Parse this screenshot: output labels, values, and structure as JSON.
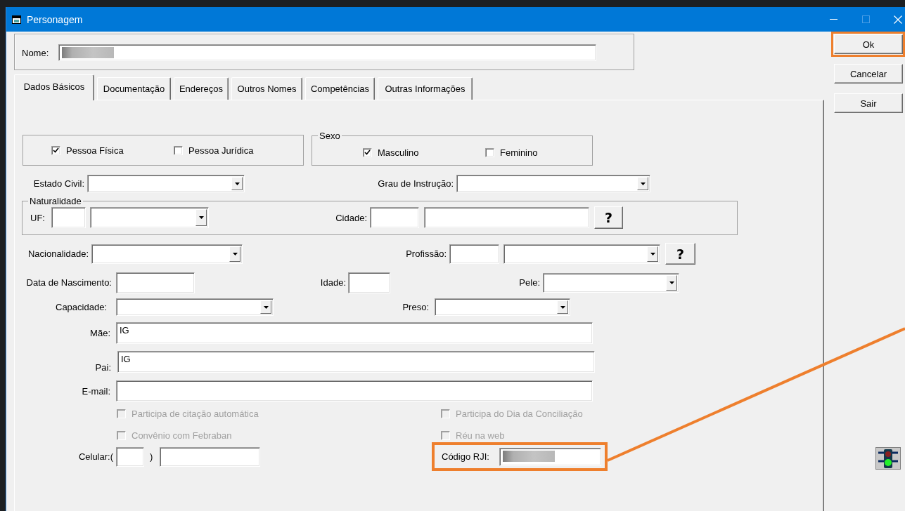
{
  "window": {
    "title": "Personagem"
  },
  "nome": {
    "label": "Nome:",
    "redacted": true
  },
  "buttons": [
    {
      "label": "Ok",
      "highlighted": true
    },
    {
      "label": "Cancelar",
      "highlighted": false
    },
    {
      "label": "Sair",
      "highlighted": false
    }
  ],
  "tabs": [
    {
      "label": "Dados Básicos",
      "selected": true
    },
    {
      "label": "Documentação",
      "selected": false
    },
    {
      "label": "Endereços",
      "selected": false
    },
    {
      "label": "Outros Nomes",
      "selected": false
    },
    {
      "label": "Competências",
      "selected": false
    },
    {
      "label": "Outras Informações",
      "selected": false
    }
  ],
  "pessoa": [
    {
      "label": "Pessoa Física",
      "checked": true
    },
    {
      "label": "Pessoa Jurídica",
      "checked": false
    }
  ],
  "sexo": {
    "title": "Sexo",
    "options": [
      {
        "label": "Masculino",
        "checked": true
      },
      {
        "label": "Feminino",
        "checked": false
      }
    ]
  },
  "estado_civil": {
    "label": "Estado Civil:"
  },
  "grau_instrucao": {
    "label": "Grau de Instrução:"
  },
  "naturalidade": {
    "title": "Naturalidade",
    "uf_label": "UF:",
    "cidade_label": "Cidade:",
    "help_button": "?"
  },
  "nacionalidade": {
    "label": "Nacionalidade:"
  },
  "profissao": {
    "label": "Profissão:",
    "help_button": "?"
  },
  "data_nascimento": {
    "label": "Data de Nascimento:"
  },
  "idade": {
    "label": "Idade:"
  },
  "pele": {
    "label": "Pele:"
  },
  "capacidade": {
    "label": "Capacidade:"
  },
  "preso": {
    "label": "Preso:"
  },
  "mae": {
    "label": "Mãe:",
    "value": "IG"
  },
  "pai": {
    "label": "Pai:",
    "value": "IG"
  },
  "email": {
    "label": "E-mail:"
  },
  "options": [
    {
      "label": "Participa de citação automática",
      "checked": false,
      "disabled": true
    },
    {
      "label": "Participa do Dia da Conciliação",
      "checked": false,
      "disabled": true
    },
    {
      "label": "Convênio com Febraban",
      "checked": false,
      "disabled": true
    },
    {
      "label": "Réu na web",
      "checked": false,
      "disabled": true
    }
  ],
  "celular": {
    "label": "Celular:(",
    "close_paren": ")"
  },
  "codigo_rji": {
    "label": "Código RJI:",
    "redacted": true,
    "highlighted": true
  },
  "callout_line": true
}
